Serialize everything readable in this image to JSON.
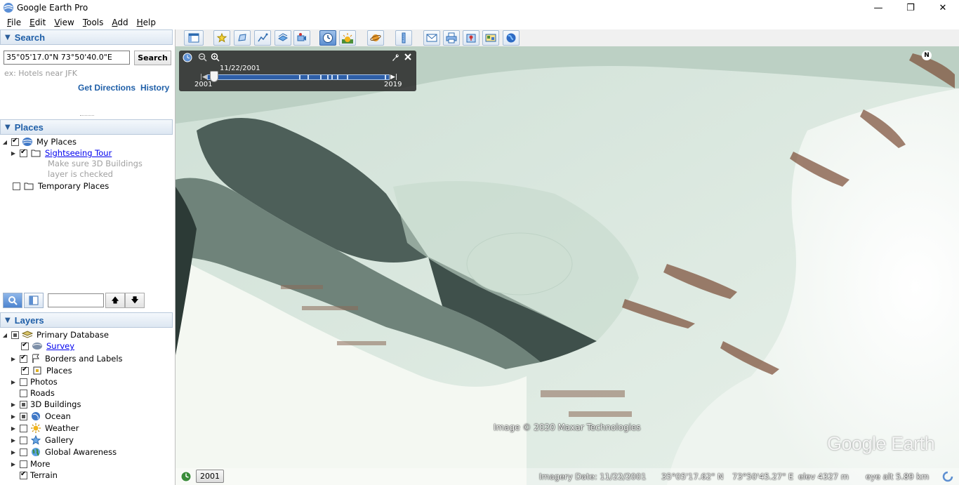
{
  "window": {
    "title": "Google Earth Pro",
    "minimize": "—",
    "maximize": "❐",
    "close": "✕"
  },
  "menu": [
    {
      "label": "File",
      "u": "F",
      "rest": "ile"
    },
    {
      "label": "Edit",
      "u": "E",
      "rest": "dit"
    },
    {
      "label": "View",
      "u": "V",
      "rest": "iew"
    },
    {
      "label": "Tools",
      "u": "T",
      "rest": "ools"
    },
    {
      "label": "Add",
      "u": "A",
      "rest": "dd"
    },
    {
      "label": "Help",
      "u": "H",
      "rest": "elp"
    }
  ],
  "search": {
    "header": "Search",
    "value": "35°05'17.0\"N 73°50'40.0\"E",
    "button": "Search",
    "hint": "ex: Hotels near JFK",
    "get_directions": "Get Directions",
    "history": "History"
  },
  "places": {
    "header": "Places",
    "my_places": "My Places",
    "sightseeing": "Sightseeing Tour",
    "note1": "Make sure 3D Buildings",
    "note2": "layer is checked",
    "temporary": "Temporary Places"
  },
  "layers": {
    "header": "Layers",
    "items": [
      {
        "label": "Primary Database"
      },
      {
        "label": "Survey"
      },
      {
        "label": "Borders and Labels"
      },
      {
        "label": "Places"
      },
      {
        "label": "Photos"
      },
      {
        "label": "Roads"
      },
      {
        "label": "3D Buildings"
      },
      {
        "label": "Ocean"
      },
      {
        "label": "Weather"
      },
      {
        "label": "Gallery"
      },
      {
        "label": "Global Awareness"
      },
      {
        "label": "More"
      },
      {
        "label": "Terrain"
      }
    ]
  },
  "timeslider": {
    "date": "11/22/2001",
    "start": "2001",
    "end": "2019"
  },
  "map": {
    "attribution": "Image © 2020 Maxar Technologies",
    "logo": "Google Earth",
    "north": "N"
  },
  "status": {
    "year_button": "2001",
    "imagery_date": "Imagery Date: 11/22/2001",
    "lat": "35°05'17.62\" N",
    "lon": "73°50'45.27\" E",
    "elev": "elev  4327 m",
    "eye_alt": "eye alt   5.89 km"
  }
}
